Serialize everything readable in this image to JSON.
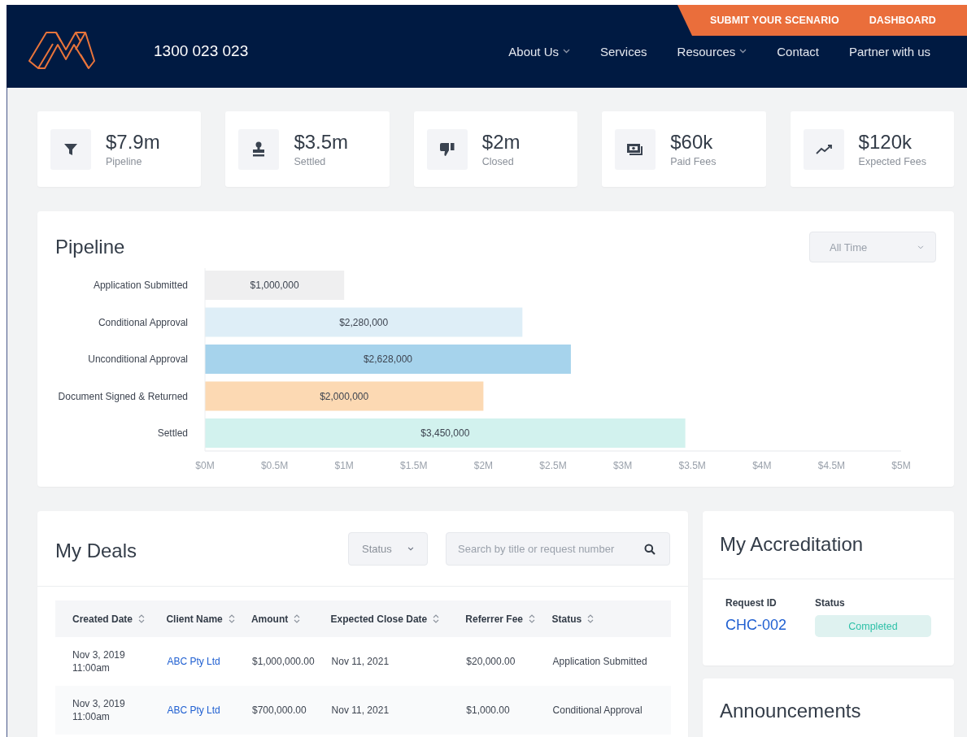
{
  "header": {
    "phone": "1300 023 023",
    "top_links": [
      {
        "label": "SUBMIT YOUR SCENARIO"
      },
      {
        "label": "DASHBOARD"
      }
    ],
    "nav": [
      {
        "label": "About Us",
        "dropdown": true
      },
      {
        "label": "Services",
        "dropdown": false
      },
      {
        "label": "Resources",
        "dropdown": true
      },
      {
        "label": "Contact",
        "dropdown": false
      },
      {
        "label": "Partner with us",
        "dropdown": false
      }
    ]
  },
  "stats": [
    {
      "value": "$7.9m",
      "label": "Pipeline"
    },
    {
      "value": "$3.5m",
      "label": "Settled"
    },
    {
      "value": "$2m",
      "label": "Closed"
    },
    {
      "value": "$60k",
      "label": "Paid Fees"
    },
    {
      "value": "$120k",
      "label": "Expected Fees"
    }
  ],
  "pipeline": {
    "title": "Pipeline",
    "filter": {
      "value": "All Time"
    },
    "chart_data": {
      "type": "bar",
      "orientation": "horizontal",
      "stacked": true,
      "series": [
        {
          "name": "Application Submitted",
          "color": "#efeff0",
          "values": [
            1000000,
            null,
            null,
            null,
            null
          ]
        },
        {
          "name": "Conditional Approval",
          "color": "#deeef7",
          "values": [
            null,
            2280000,
            null,
            null,
            null
          ]
        },
        {
          "name": "Unconditional Approval",
          "color": "#a6d3ec",
          "values": [
            null,
            null,
            2628000,
            null,
            null
          ]
        },
        {
          "name": "Document Signed & Returned",
          "color": "#fcd9b3",
          "values": [
            null,
            null,
            null,
            2000000,
            null
          ]
        },
        {
          "name": "Settled",
          "color": "#d2f2ee",
          "values": [
            null,
            null,
            null,
            null,
            3450000
          ]
        }
      ],
      "value_labels": [
        "$1,000,000",
        "$2,280,000",
        "$2,628,000",
        "$2,000,000",
        "$3,450,000"
      ],
      "xlim": [
        0,
        5000000
      ],
      "xticks": [
        {
          "value": 0,
          "label": "$0M"
        },
        {
          "value": 500000,
          "label": "$0.5M"
        },
        {
          "value": 1000000,
          "label": "$1M"
        },
        {
          "value": 1500000,
          "label": "$1.5M"
        },
        {
          "value": 2000000,
          "label": "$2M"
        },
        {
          "value": 2500000,
          "label": "$2.5M"
        },
        {
          "value": 3000000,
          "label": "$3M"
        },
        {
          "value": 3500000,
          "label": "$3.5M"
        },
        {
          "value": 4000000,
          "label": "$4M"
        },
        {
          "value": 4500000,
          "label": "$4.5M"
        },
        {
          "value": 5000000,
          "label": "$5M"
        }
      ]
    }
  },
  "deals": {
    "title": "My Deals",
    "status_filter": {
      "placeholder": "Status"
    },
    "search": {
      "placeholder": "Search by title or request number"
    },
    "columns": [
      "Created Date",
      "Client Name",
      "Amount",
      "Expected Close Date",
      "Referrer Fee",
      "Status"
    ],
    "rows": [
      {
        "created": "Nov 3, 2019\n11:00am",
        "client": "ABC Pty Ltd",
        "amount": "$1,000,000.00",
        "close_date": "Nov 11, 2021",
        "fee": "$20,000.00",
        "status": "Application Submitted"
      },
      {
        "created": "Nov 3, 2019\n11:00am",
        "client": "ABC Pty Ltd",
        "amount": "$700,000.00",
        "close_date": "Nov 11, 2021",
        "fee": "$1,000.00",
        "status": "Conditional Approval"
      }
    ]
  },
  "accreditation": {
    "title": "My Accreditation",
    "columns": [
      "Request ID",
      "Status"
    ],
    "request_id": "CHC-002",
    "status": "Completed"
  },
  "announcements": {
    "title": "Announcements"
  }
}
